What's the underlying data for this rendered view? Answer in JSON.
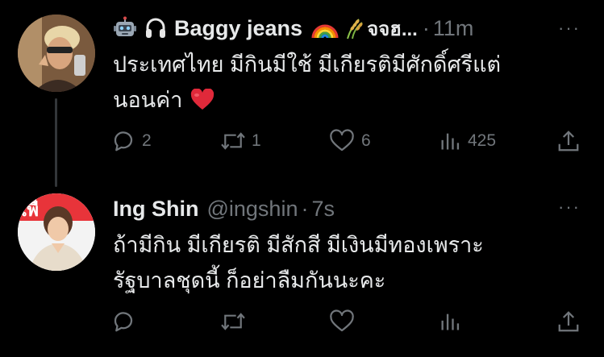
{
  "tweet1": {
    "name": "Baggy jeans",
    "handle_truncated": "จจฮ...",
    "time": "11m",
    "time_sep": "·",
    "text_line1": "ประเทศไทย มีกินมีใช้ มีเกียรติมีศักดิ์ศรีแต่",
    "text_line2": "นอนค่า",
    "reply_count": "2",
    "retweet_count": "1",
    "like_count": "6",
    "view_count": "425"
  },
  "tweet2": {
    "name": "Ing Shin",
    "handle": "@ingshin",
    "time_sep": "·",
    "time": "7s",
    "text_line1": "ถ้ามีกิน มีเกียรติ มีสักสี มีเงินมีทองเพราะ",
    "text_line2": "รัฐบาลชุดนี้ ก็อย่าลืมกันนะคะ"
  },
  "more_label": "···",
  "colors": {
    "background": "#000000",
    "text": "#e7e9ea",
    "muted": "#71767b",
    "heart": "#e0293a"
  },
  "icons": [
    "robot-icon",
    "headphones-icon",
    "rainbow-icon",
    "rice-icon",
    "heart-emoji-icon",
    "reply-icon",
    "retweet-icon",
    "like-icon",
    "views-icon",
    "share-icon",
    "more-icon"
  ]
}
